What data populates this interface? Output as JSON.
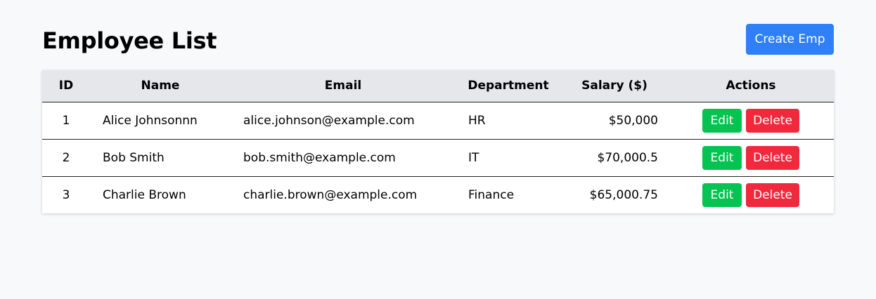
{
  "header": {
    "title": "Employee List",
    "create_label": "Create Emp"
  },
  "colors": {
    "primary": "#2f80f7",
    "success": "#05c351",
    "danger": "#f2283d",
    "header_bg": "#e5e7eb",
    "page_bg": "#f8f9fb"
  },
  "table": {
    "columns": [
      "ID",
      "Name",
      "Email",
      "Department",
      "Salary ($)",
      "Actions"
    ],
    "rows": [
      {
        "id": "1",
        "name": "Alice Johnsonnn",
        "email": "alice.johnson@example.com",
        "department": "HR",
        "salary": "$50,000"
      },
      {
        "id": "2",
        "name": "Bob Smith",
        "email": "bob.smith@example.com",
        "department": "IT",
        "salary": "$70,000.5"
      },
      {
        "id": "3",
        "name": "Charlie Brown",
        "email": "charlie.brown@example.com",
        "department": "Finance",
        "salary": "$65,000.75"
      }
    ],
    "edit_label": "Edit",
    "delete_label": "Delete"
  }
}
